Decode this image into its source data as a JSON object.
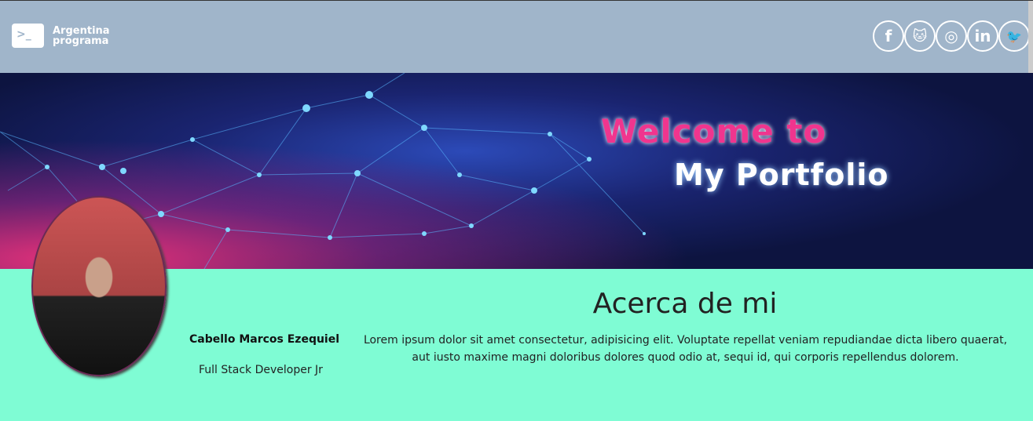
{
  "nav": {
    "logo_line1": "Argentina",
    "logo_line2": "programa",
    "logo_glyph": ">_",
    "social": [
      {
        "name": "facebook",
        "glyph": "f"
      },
      {
        "name": "github",
        "glyph": "🐱"
      },
      {
        "name": "instagram",
        "glyph": "◎"
      },
      {
        "name": "linkedin",
        "glyph": "in"
      },
      {
        "name": "twitter",
        "glyph": "🐦"
      }
    ]
  },
  "banner": {
    "line1": "Welcome to",
    "line2": "My Portfolio"
  },
  "profile": {
    "name": "Cabello Marcos Ezequiel",
    "role": "Full Stack Developer Jr"
  },
  "about": {
    "title": "Acerca de mi",
    "text": "Lorem ipsum dolor sit amet consectetur, adipisicing elit. Voluptate repellat veniam repudiandae dicta libero quaerat, aut iusto maxime magni doloribus dolores quod odio at, sequi id, qui corporis repellendus dolorem."
  }
}
